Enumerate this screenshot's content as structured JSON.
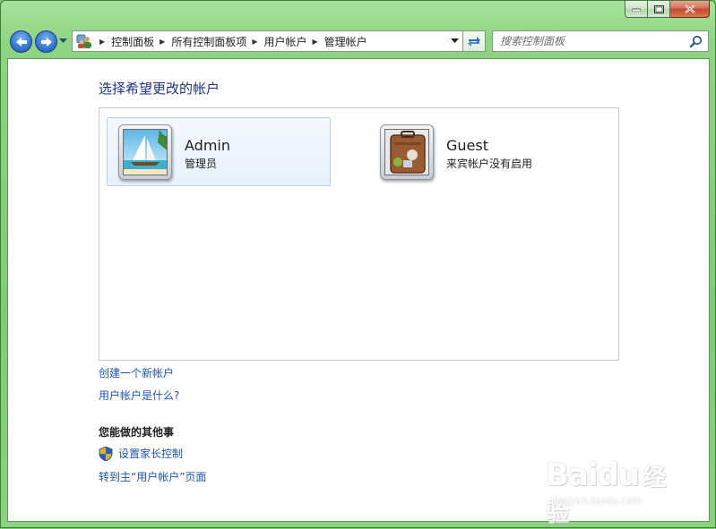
{
  "window": {
    "caption_buttons": [
      "minimize",
      "maximize",
      "close"
    ]
  },
  "navigation": {
    "breadcrumbs": [
      "控制面板",
      "所有控制面板项",
      "用户帐户",
      "管理帐户"
    ]
  },
  "search": {
    "placeholder": "搜索控制面板"
  },
  "main": {
    "title": "选择希望更改的帐户",
    "accounts": [
      {
        "name": "Admin",
        "subtitle": "管理员",
        "icon": "sailboat-avatar",
        "selected": true
      },
      {
        "name": "Guest",
        "subtitle": "来宾帐户没有启用",
        "icon": "suitcase-avatar",
        "selected": false
      }
    ],
    "links": {
      "create": "创建一个新帐户",
      "what": "用户帐户是什么?"
    },
    "other_section": {
      "heading": "您能做的其他事",
      "parental": "设置家长控制",
      "main_page": "转到主“用户帐户”页面"
    }
  },
  "watermark": {
    "logo": "Baidu",
    "logo_cn": "经验",
    "url": "jingyan.baidu.com"
  },
  "colors": {
    "frame": "#8ed483",
    "link": "#1e55b4",
    "title": "#1e3287",
    "selection": "#e8f1fc"
  }
}
